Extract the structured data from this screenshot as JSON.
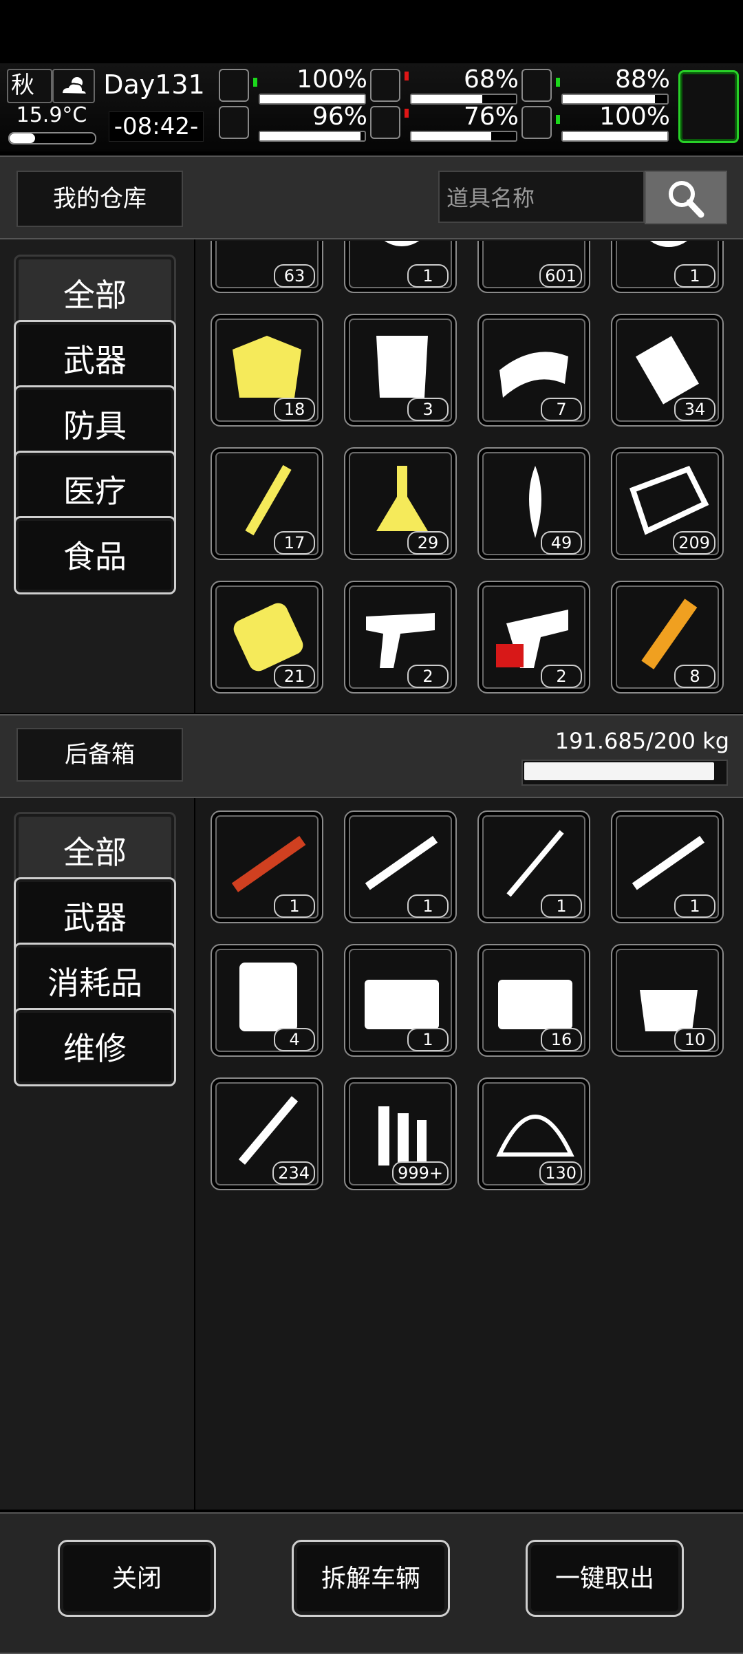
{
  "status": {
    "season": "秋",
    "temperature": "15.9°C",
    "temperature_level": 0.3,
    "day": "Day131",
    "time": "-08:42-",
    "stats": [
      {
        "icon": "medkit-icon",
        "trend": "up",
        "value": "100%",
        "level": 1.0
      },
      {
        "icon": "stomach-icon",
        "trend": "down",
        "value": "68%",
        "level": 0.68
      },
      {
        "icon": "pill-icon",
        "trend": "up",
        "value": "88%",
        "level": 0.88
      },
      {
        "icon": "leg-icon",
        "trend": "none",
        "value": "96%",
        "level": 0.96
      },
      {
        "icon": "water-drop-icon",
        "trend": "down",
        "value": "76%",
        "level": 0.76
      },
      {
        "icon": "heart-icon",
        "trend": "up",
        "value": "100%",
        "level": 1.0
      }
    ]
  },
  "warehouse": {
    "title": "我的仓库",
    "search_placeholder": "道具名称",
    "categories": [
      "全部",
      "武器",
      "防具",
      "医疗",
      "食品"
    ],
    "items": [
      {
        "icon": "round-item-icon",
        "count": "63",
        "color": "#ffffff"
      },
      {
        "icon": "tire-icon",
        "count": "1",
        "color": "#ffffff"
      },
      {
        "icon": "pipe-icon",
        "count": "601",
        "color": "#ffffff"
      },
      {
        "icon": "wheel-icon",
        "count": "1",
        "color": "#ffffff"
      },
      {
        "icon": "cloth-icon",
        "count": "18",
        "color": "#f5ea5a"
      },
      {
        "icon": "fur-icon",
        "count": "3",
        "color": "#ffffff"
      },
      {
        "icon": "bandage-roll-icon",
        "count": "7",
        "color": "#ffffff"
      },
      {
        "icon": "paper-roll-icon",
        "count": "34",
        "color": "#ffffff"
      },
      {
        "icon": "syringe-icon",
        "count": "17",
        "color": "#f5ea5a"
      },
      {
        "icon": "flask-icon",
        "count": "29",
        "color": "#f5ea5a"
      },
      {
        "icon": "wheat-icon",
        "count": "49",
        "color": "#ffffff"
      },
      {
        "icon": "paper-scrap-icon",
        "count": "209",
        "color": "#ffffff"
      },
      {
        "icon": "spool-icon",
        "count": "21",
        "color": "#f5ea5a"
      },
      {
        "icon": "pistol-icon",
        "count": "2",
        "color": "#ffffff"
      },
      {
        "icon": "flare-gun-icon",
        "count": "2",
        "color": "#ffffff"
      },
      {
        "icon": "rocket-ammo-icon",
        "count": "8",
        "color": "#f0a020"
      }
    ]
  },
  "trunk": {
    "title": "后备箱",
    "weight": "191.685/200 kg",
    "weight_level": 0.958,
    "categories": [
      "全部",
      "武器",
      "消耗品",
      "维修"
    ],
    "items": [
      {
        "icon": "rpg-launcher-icon",
        "count": "1",
        "color": "#d04020"
      },
      {
        "icon": "assault-rifle-icon",
        "count": "1",
        "color": "#ffffff"
      },
      {
        "icon": "katana-icon",
        "count": "1",
        "color": "#ffffff"
      },
      {
        "icon": "rifle-icon",
        "count": "1",
        "color": "#ffffff"
      },
      {
        "icon": "tool-case-icon",
        "count": "4",
        "color": "#ffffff"
      },
      {
        "icon": "car-toolbox-icon",
        "count": "1",
        "color": "#ffffff"
      },
      {
        "icon": "car-repair-kit-icon",
        "count": "16",
        "color": "#ffffff"
      },
      {
        "icon": "tool-bag-icon",
        "count": "10",
        "color": "#ffffff"
      },
      {
        "icon": "rpg-rocket-icon",
        "count": "234",
        "color": "#ffffff"
      },
      {
        "icon": "bullets-icon",
        "count": "999+",
        "color": "#ffffff"
      },
      {
        "icon": "net-helmet-icon",
        "count": "130",
        "color": "#ffffff"
      }
    ]
  },
  "actions": {
    "close": "关闭",
    "dismantle": "拆解车辆",
    "take_all": "一键取出"
  }
}
